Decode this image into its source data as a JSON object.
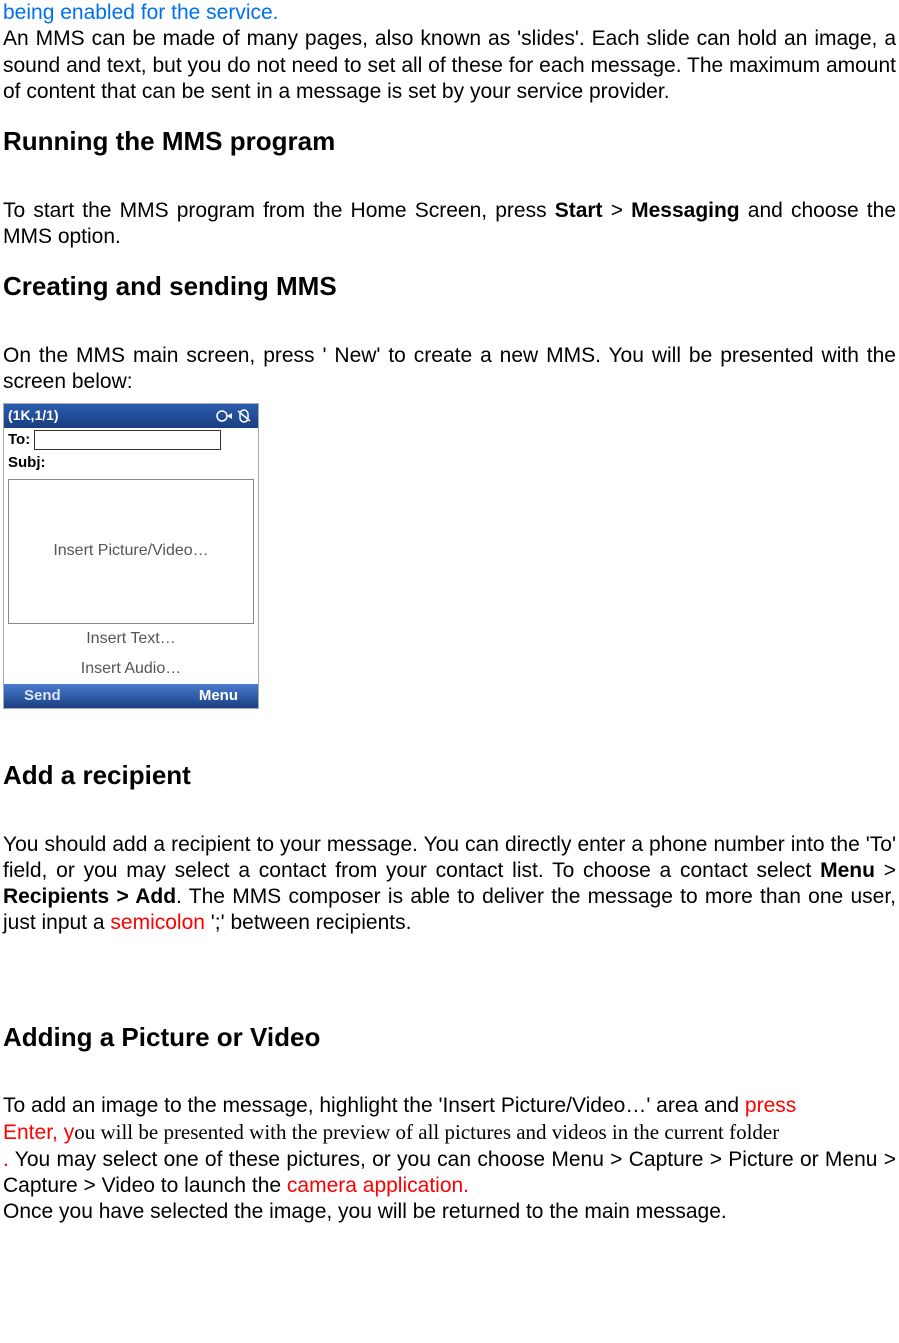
{
  "intro": {
    "blue_line": "being enabled for the service.",
    "para1": "An MMS can be made of many pages, also known as 'slides'. Each slide can hold an image, a sound and text, but you do not need to set all of these for each message. The maximum amount of content that can be sent in a message is set by your service provider."
  },
  "running": {
    "heading": "Running the MMS program",
    "para_pre": "To start the MMS program from the Home Screen, press ",
    "start": "Start",
    "gt1": " > ",
    "messaging": "Messaging",
    "para_post": " and choose the MMS option."
  },
  "creating": {
    "heading": "Creating and sending MMS",
    "para": "On the MMS main screen, press ' New' to create a new MMS. You will be presented with the screen below:"
  },
  "screenshot": {
    "title": "(1K,1/1)",
    "to_label": "To:",
    "to_value": "",
    "subj_label": "Subj:",
    "insert_pic": "Insert Picture/Video…",
    "insert_text": "Insert Text…",
    "insert_audio": "Insert Audio…",
    "send": "Send",
    "menu": "Menu"
  },
  "recipient": {
    "heading": "Add a recipient",
    "para_pre": "You should add a recipient to your message. You can directly enter a phone number into the 'To' field, or you may select a contact from your contact list. To choose a contact select ",
    "menu": "Menu",
    "gt1": " > ",
    "recip": "Recipients > Add",
    "para_mid": ". The MMS composer is able to deliver the message to more than one user, just input a ",
    "semicolon": "semicolon",
    "para_post": " ';' between recipients."
  },
  "picture": {
    "heading": "Adding a Picture or Video",
    "line1_pre": "To add an image to the message, highlight the 'Insert Picture/Video…' area and ",
    "press": "press ",
    "enter_y": "Enter, y",
    "mixed": "ou will be presented with the preview of all pictures and videos in the current folder",
    "period": ".",
    "line2": " You may select one of these pictures, or you can choose Menu > Capture > Picture or Menu > Capture > Video to launch the ",
    "camera": "camera application.",
    "line3": "Once you have selected the image, you will be returned to the main message."
  }
}
